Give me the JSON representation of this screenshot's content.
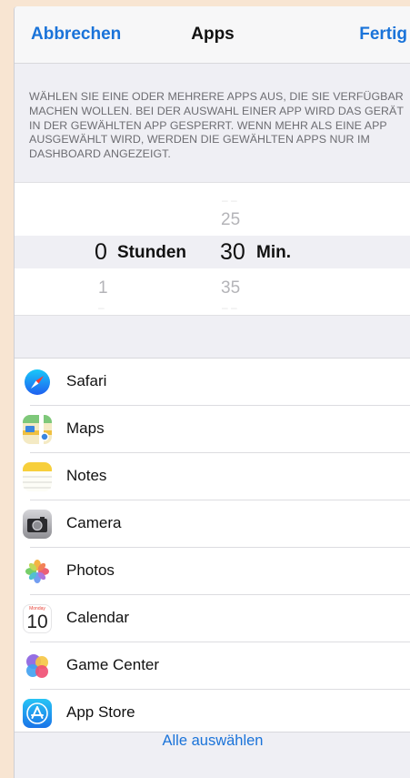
{
  "header": {
    "cancel_label": "Abbrechen",
    "title": "Apps",
    "done_label": "Fertig"
  },
  "description": "WÄHLEN SIE EINE ODER MEHRERE APPS AUS, DIE SIE VERFÜGBAR MACHEN WOLLEN. BEI DER AUSWAHL EINER APP WIRD DAS GERÄT IN DER GEWÄHLTEN APP GESPERRT. WENN MEHR ALS EINE APP AUSGEWÄHLT WIRD, WERDEN DIE GEWÄHLTEN APPS NUR IM DASHBOARD ANGEZEIGT.",
  "picker": {
    "hours_selected": "0",
    "hours_next": "1",
    "hours_unit": "Stunden",
    "minutes_prev": "25",
    "minutes_selected": "30",
    "minutes_next": "35",
    "minutes_unit": "Min."
  },
  "apps": [
    {
      "label": "Safari",
      "icon": "safari-icon"
    },
    {
      "label": "Maps",
      "icon": "maps-icon"
    },
    {
      "label": "Notes",
      "icon": "notes-icon"
    },
    {
      "label": "Camera",
      "icon": "camera-icon"
    },
    {
      "label": "Photos",
      "icon": "photos-icon"
    },
    {
      "label": "Calendar",
      "icon": "calendar-icon",
      "icon_day": "Monday",
      "icon_date": "10"
    },
    {
      "label": "Game Center",
      "icon": "game-center-icon"
    },
    {
      "label": "App Store",
      "icon": "app-store-icon"
    }
  ],
  "select_all_label": "Alle auswählen",
  "colors": {
    "accent": "#1a73d9",
    "background": "#efeff4",
    "outer": "#f8e5d2"
  }
}
